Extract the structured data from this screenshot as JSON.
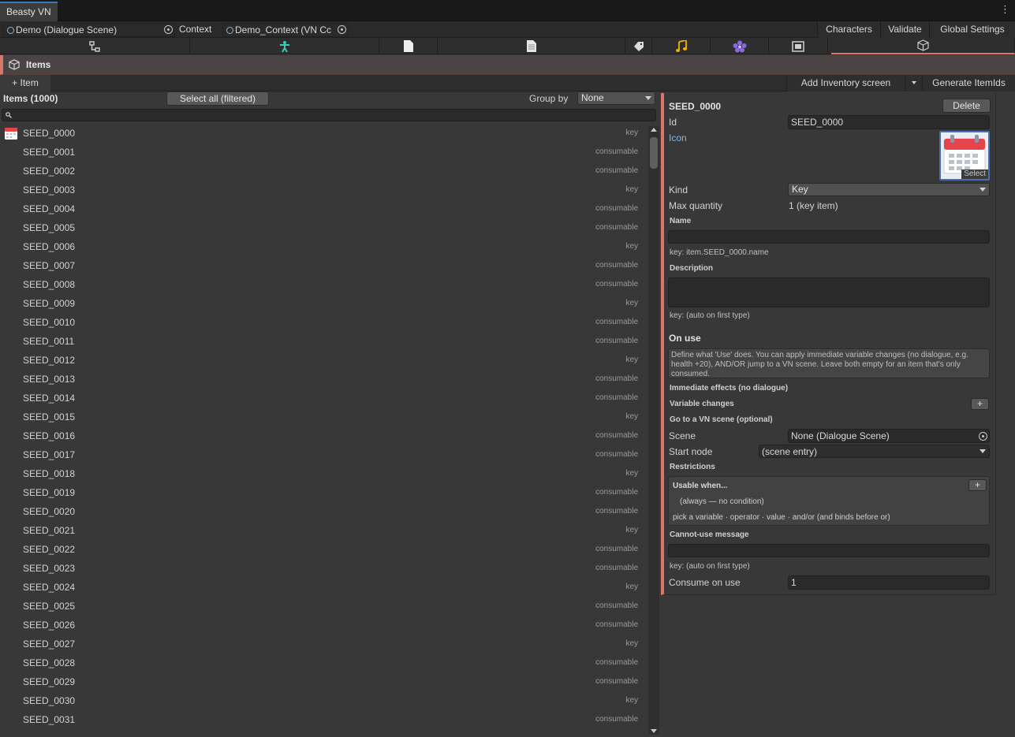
{
  "window": {
    "title": "Beasty VN"
  },
  "toolbar": {
    "scene_field": "Demo (Dialogue Scene)",
    "context_label": "Context",
    "context_field": "Demo_Context (VN Cc",
    "characters": "Characters",
    "validate": "Validate",
    "global_settings": "Global Settings"
  },
  "tabs": [
    {
      "icon": "graph-icon"
    },
    {
      "icon": "character-icon"
    },
    {
      "icon": "page-icon"
    },
    {
      "icon": "document-icon"
    },
    {
      "icon": "tag-icon"
    },
    {
      "icon": "music-icon"
    },
    {
      "icon": "flower-icon"
    },
    {
      "icon": "screen-icon"
    },
    {
      "icon": "box-icon"
    }
  ],
  "section": {
    "title": "Items"
  },
  "actions": {
    "add_item": "+ Item",
    "add_inventory_screen": "Add Inventory screen",
    "generate_itemids": "Generate ItemIds"
  },
  "list": {
    "title": "Items (1000)",
    "select_all": "Select all (filtered)",
    "group_by_label": "Group by",
    "group_by_value": "None",
    "items": [
      {
        "name": "SEED_0000",
        "kind": "key"
      },
      {
        "name": "SEED_0001",
        "kind": "consumable"
      },
      {
        "name": "SEED_0002",
        "kind": "consumable"
      },
      {
        "name": "SEED_0003",
        "kind": "key"
      },
      {
        "name": "SEED_0004",
        "kind": "consumable"
      },
      {
        "name": "SEED_0005",
        "kind": "consumable"
      },
      {
        "name": "SEED_0006",
        "kind": "key"
      },
      {
        "name": "SEED_0007",
        "kind": "consumable"
      },
      {
        "name": "SEED_0008",
        "kind": "consumable"
      },
      {
        "name": "SEED_0009",
        "kind": "key"
      },
      {
        "name": "SEED_0010",
        "kind": "consumable"
      },
      {
        "name": "SEED_0011",
        "kind": "consumable"
      },
      {
        "name": "SEED_0012",
        "kind": "key"
      },
      {
        "name": "SEED_0013",
        "kind": "consumable"
      },
      {
        "name": "SEED_0014",
        "kind": "consumable"
      },
      {
        "name": "SEED_0015",
        "kind": "key"
      },
      {
        "name": "SEED_0016",
        "kind": "consumable"
      },
      {
        "name": "SEED_0017",
        "kind": "consumable"
      },
      {
        "name": "SEED_0018",
        "kind": "key"
      },
      {
        "name": "SEED_0019",
        "kind": "consumable"
      },
      {
        "name": "SEED_0020",
        "kind": "consumable"
      },
      {
        "name": "SEED_0021",
        "kind": "key"
      },
      {
        "name": "SEED_0022",
        "kind": "consumable"
      },
      {
        "name": "SEED_0023",
        "kind": "consumable"
      },
      {
        "name": "SEED_0024",
        "kind": "key"
      },
      {
        "name": "SEED_0025",
        "kind": "consumable"
      },
      {
        "name": "SEED_0026",
        "kind": "consumable"
      },
      {
        "name": "SEED_0027",
        "kind": "key"
      },
      {
        "name": "SEED_0028",
        "kind": "consumable"
      },
      {
        "name": "SEED_0029",
        "kind": "consumable"
      },
      {
        "name": "SEED_0030",
        "kind": "key"
      },
      {
        "name": "SEED_0031",
        "kind": "consumable"
      }
    ]
  },
  "inspector": {
    "header": "SEED_0000",
    "delete": "Delete",
    "id_label": "Id",
    "id_value": "SEED_0000",
    "icon_label": "Icon",
    "icon_select": "Select",
    "kind_label": "Kind",
    "kind_value": "Key",
    "max_quantity_label": "Max quantity",
    "max_quantity_value": "1 (key item)",
    "name_label": "Name",
    "name_key": "key: item.SEED_0000.name",
    "description_label": "Description",
    "description_key": "key: (auto on first type)",
    "on_use": "On use",
    "on_use_help": "Define what 'Use' does. You can apply immediate variable changes (no dialogue, e.g. health +20), AND/OR jump to a VN scene. Leave both empty for an item that's only consumed.",
    "immediate_effects": "Immediate effects (no dialogue)",
    "variable_changes": "Variable changes",
    "goto_scene": "Go to a VN scene (optional)",
    "scene_label": "Scene",
    "scene_value": "None (Dialogue Scene)",
    "start_node_label": "Start node",
    "start_node_value": "(scene entry)",
    "restrictions": "Restrictions",
    "usable_when": "Usable when...",
    "always": "(always — no condition)",
    "pick_hint": "pick a variable · operator · value · and/or  (and binds before or)",
    "cannot_use_label": "Cannot-use message",
    "cannot_use_key": "key: (auto on first type)",
    "consume_label": "Consume on use",
    "consume_value": "1"
  },
  "colors": {
    "accent": "#d9786a",
    "link": "#7fb6ea"
  }
}
